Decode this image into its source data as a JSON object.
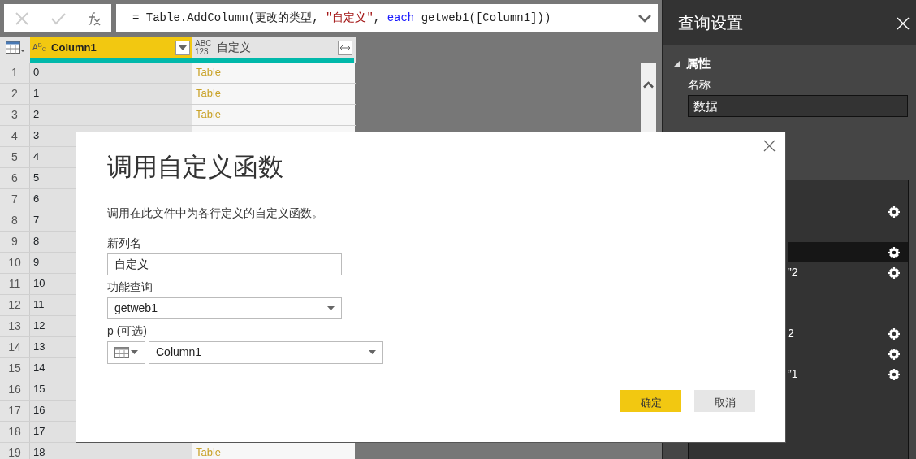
{
  "formula_bar": {
    "segments": [
      {
        "text": "= Table.AddColumn(更改的类型, ",
        "kind": "code"
      },
      {
        "text": "\"自定义\"",
        "kind": "string"
      },
      {
        "text": ", ",
        "kind": "code"
      },
      {
        "text": "each",
        "kind": "keyword"
      },
      {
        "text": " getweb1([Column1]))",
        "kind": "code"
      }
    ]
  },
  "table": {
    "columns": [
      {
        "type_icon": [
          "A$^{B}$$_{C}$"
        ],
        "name": "Column1",
        "selected": true
      },
      {
        "type_icon": [
          "ABC",
          "123"
        ],
        "name": "自定义",
        "selected": false
      }
    ],
    "rows": [
      {
        "num": "1",
        "value": "0",
        "custom": "Table"
      },
      {
        "num": "2",
        "value": "1",
        "custom": "Table"
      },
      {
        "num": "3",
        "value": "2",
        "custom": "Table"
      },
      {
        "num": "4",
        "value": "3"
      },
      {
        "num": "5",
        "value": "4"
      },
      {
        "num": "6",
        "value": "5"
      },
      {
        "num": "7",
        "value": "6"
      },
      {
        "num": "8",
        "value": "7"
      },
      {
        "num": "9",
        "value": "8"
      },
      {
        "num": "10",
        "value": "9"
      },
      {
        "num": "11",
        "value": "10"
      },
      {
        "num": "12",
        "value": "11"
      },
      {
        "num": "13",
        "value": "12"
      },
      {
        "num": "14",
        "value": "13"
      },
      {
        "num": "15",
        "value": "14"
      },
      {
        "num": "16",
        "value": "15"
      },
      {
        "num": "17",
        "value": "16"
      },
      {
        "num": "18",
        "value": "17"
      },
      {
        "num": "19",
        "value": "18",
        "custom": "Table"
      }
    ]
  },
  "query_settings": {
    "title": "查询设置",
    "section": "属性",
    "name_label": "名称",
    "name_value": "数据",
    "steps": [
      {
        "gear": true,
        "selected": false
      },
      {
        "gear": false,
        "selected": false
      },
      {
        "gear": true,
        "selected": true
      },
      {
        "text": "”2",
        "gear": true,
        "selected": false
      },
      {
        "gear": false,
        "selected": false
      },
      {
        "gear": false,
        "selected": false
      },
      {
        "text": "2",
        "gear": true,
        "selected": false
      },
      {
        "gear": true,
        "selected": false
      },
      {
        "text": "”1",
        "gear": true,
        "selected": false
      }
    ]
  },
  "dialog": {
    "title": "调用自定义函数",
    "description": "调用在此文件中为各行定义的自定义函数。",
    "fields": [
      {
        "kind": "text",
        "label": "新列名",
        "value": "自定义"
      },
      {
        "kind": "select",
        "label": "功能查询",
        "value": "getweb1"
      },
      {
        "kind": "param",
        "label": "p (可选)",
        "value": "Column1"
      }
    ],
    "buttons": [
      {
        "label": "确定",
        "primary": true
      },
      {
        "label": "取消",
        "primary": false
      }
    ]
  }
}
